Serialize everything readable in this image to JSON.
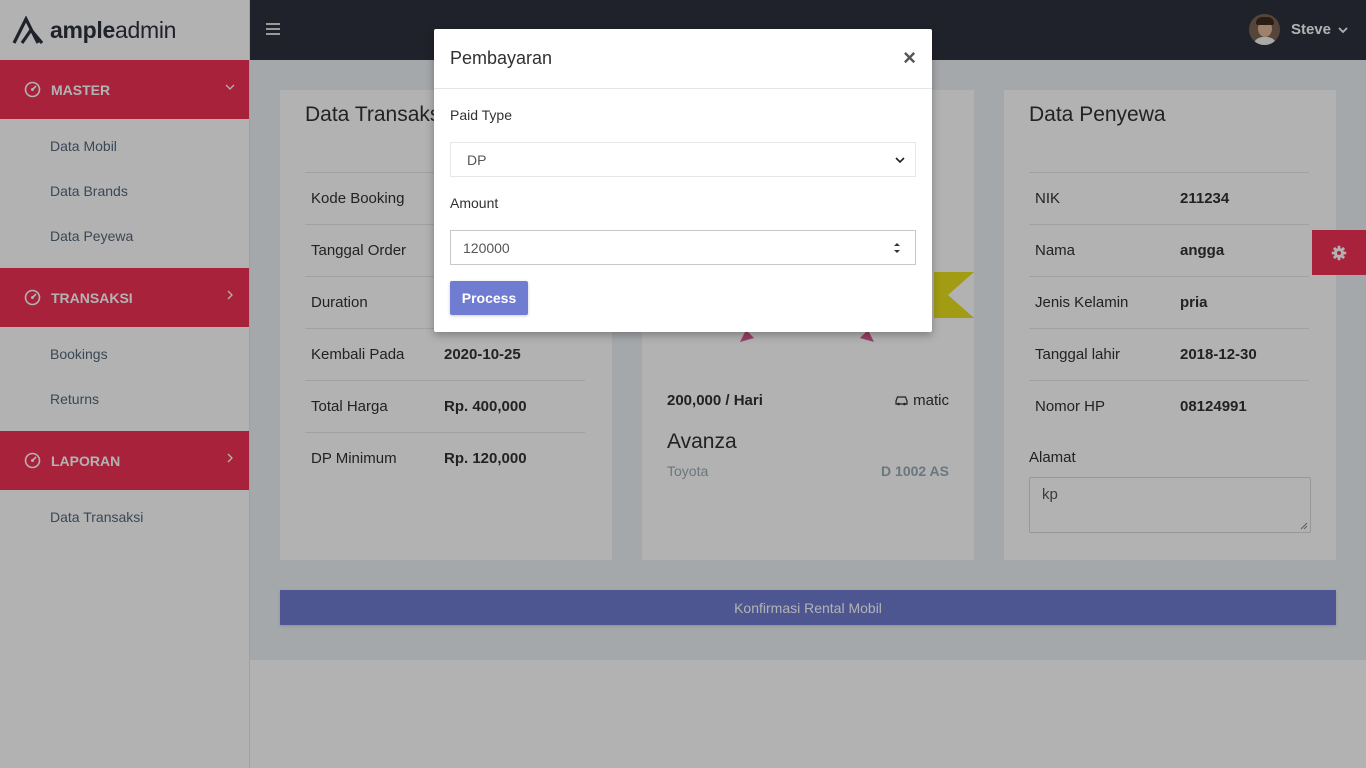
{
  "brand": {
    "name_bold": "ample",
    "name_light": "admin"
  },
  "sidebar": {
    "groups": [
      {
        "label": "MASTER",
        "items": [
          "Data Mobil",
          "Data Brands",
          "Data Peyewa"
        ]
      },
      {
        "label": "TRANSAKSI",
        "items": [
          "Bookings",
          "Returns"
        ]
      },
      {
        "label": "LAPORAN",
        "items": [
          "Data Transaksi"
        ]
      }
    ]
  },
  "topbar": {
    "user_name": "Steve"
  },
  "transaksi": {
    "title": "Data Transaksi",
    "rows": [
      {
        "label": "Kode Booking",
        "value": ""
      },
      {
        "label": "Tanggal Order",
        "value": ""
      },
      {
        "label": "Duration",
        "value": ""
      },
      {
        "label": "Kembali Pada",
        "value": "2020-10-25"
      },
      {
        "label": "Total Harga",
        "value": "Rp. 400,000"
      },
      {
        "label": "DP Minimum",
        "value": "Rp. 120,000"
      }
    ]
  },
  "mobil": {
    "price": "200,000 / Hari",
    "transmission": "matic",
    "name": "Avanza",
    "brand": "Toyota",
    "plate": "D 1002 AS"
  },
  "penyewa": {
    "title": "Data Penyewa",
    "rows": [
      {
        "label": "NIK",
        "value": "211234"
      },
      {
        "label": "Nama",
        "value": "angga"
      },
      {
        "label": "Jenis Kelamin",
        "value": "pria"
      },
      {
        "label": "Tanggal lahir",
        "value": "2018-12-30"
      },
      {
        "label": "Nomor HP",
        "value": "08124991"
      }
    ],
    "alamat_label": "Alamat",
    "alamat_value": "kp"
  },
  "confirm_label": "Konfirmasi Rental Mobil",
  "modal": {
    "title": "Pembayaran",
    "close": "×",
    "paid_type_label": "Paid Type",
    "paid_type_value": "DP",
    "amount_label": "Amount",
    "amount_value": "120000",
    "process_label": "Process"
  },
  "colors": {
    "accent_red": "#f33155",
    "primary": "#707cd2",
    "topbar": "#2f323e",
    "content_bg": "#edf1f5"
  },
  "icons": {
    "menu": "hamburger-icon",
    "group": "dashboard-dial-icon",
    "settings": "gear-icon",
    "close": "close-icon",
    "transmission": "car-icon"
  }
}
